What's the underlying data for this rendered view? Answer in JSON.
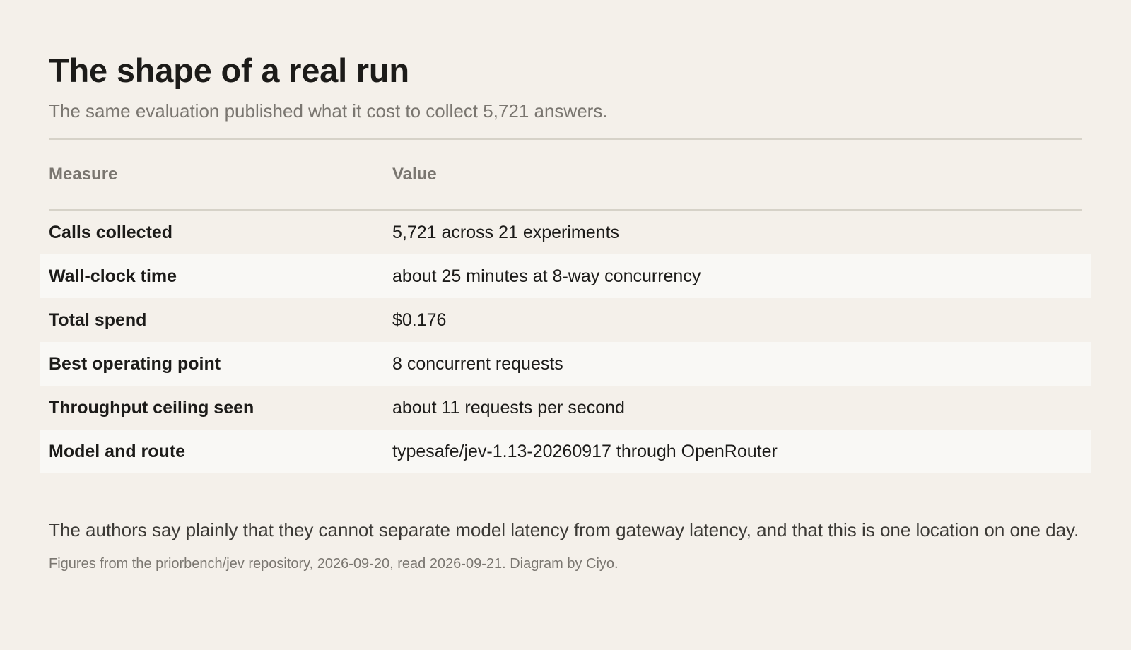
{
  "header": {
    "title": "The shape of a real run",
    "subtitle": "The same evaluation published what it cost to collect 5,721 answers."
  },
  "table": {
    "columns": [
      "Measure",
      "Value"
    ],
    "rows": [
      {
        "measure": "Calls collected",
        "value": "5,721 across 21 experiments"
      },
      {
        "measure": "Wall-clock time",
        "value": "about 25 minutes at 8-way concurrency"
      },
      {
        "measure": "Total spend",
        "value": "$0.176"
      },
      {
        "measure": "Best operating point",
        "value": "8 concurrent requests"
      },
      {
        "measure": "Throughput ceiling seen",
        "value": "about 11 requests per second"
      },
      {
        "measure": "Model and route",
        "value": "typesafe/jev-1.13-20260917 through OpenRouter"
      }
    ]
  },
  "note": "The authors say plainly that they cannot separate model latency from gateway latency, and that this is one location on one day.",
  "source": "Figures from the priorbench/jev repository, 2026-09-20, read 2026-09-21. Diagram by Ciyo.",
  "colors": {
    "background": "#f4f0ea",
    "row_alt": "#f9f8f5",
    "rule": "#d6d2c8",
    "muted_text": "#7a7670",
    "text": "#1c1b19"
  }
}
